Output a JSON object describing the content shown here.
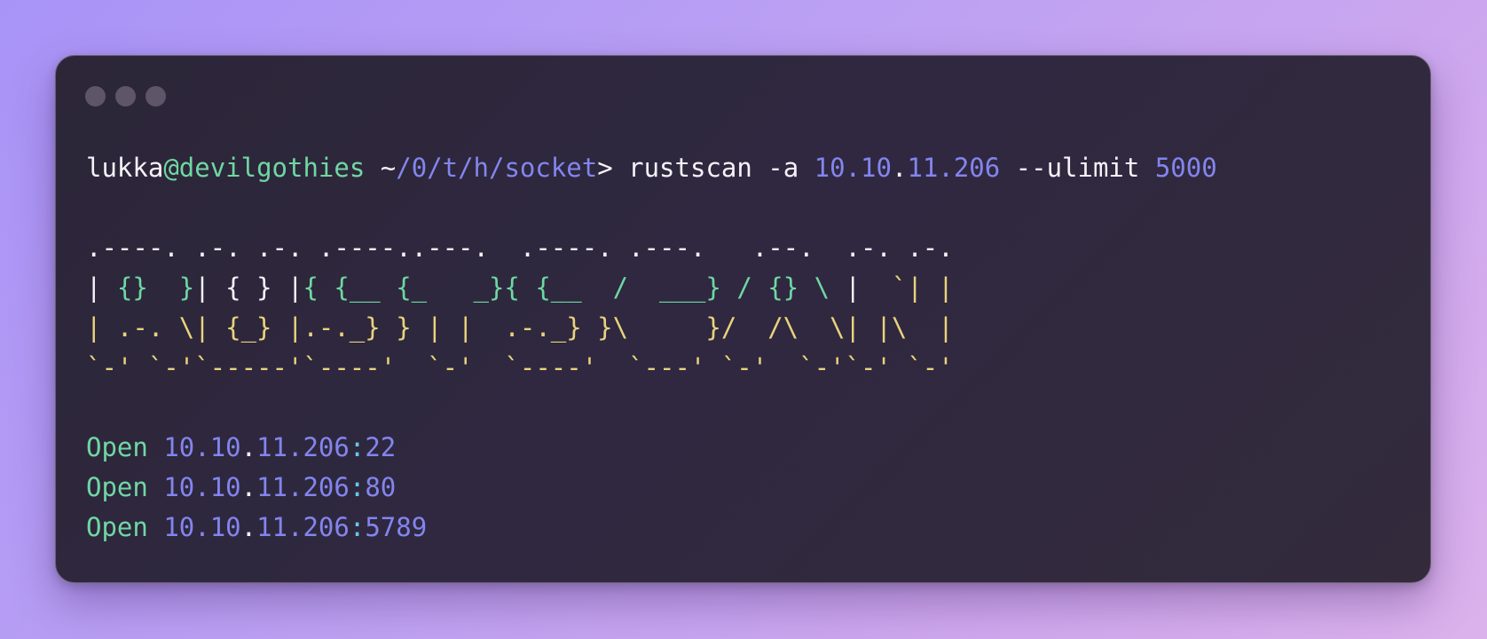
{
  "window": {
    "controls": [
      "close",
      "minimize",
      "maximize"
    ]
  },
  "prompt": {
    "user": "lukka",
    "host": "@devilgothies",
    "space": " ",
    "tilde": "~",
    "path": "/0/t/h/socket",
    "arrow": "> ",
    "command": "rustscan -a ",
    "ip_a": "10.10",
    "ip_dot": ".",
    "ip_b": "11.206",
    "flag": " --ulimit ",
    "limit": "5000"
  },
  "banner": {
    "line1": ".----. .-. .-. .----..---.  .----. .---.   .--.  .-. .-.",
    "line2": {
      "a": "| ",
      "b": "{}",
      "c": "  ",
      "d": "}",
      "e": "| { } |",
      "f": "{ {__ {_   _}{ {__  /  ___} / {} \\",
      "g": " | ",
      "h": " `| |"
    },
    "line3": "| .-. \\| {_} |.-._} } | |  .-._} }\\     }/  /\\  \\| |\\  |",
    "line4": "`-' `-'`-----'`----'  `-'  `----'  `---' `-'  `-'`-' `-'"
  },
  "results": [
    {
      "status": "Open",
      "ip_a": "10.10",
      "ip_dot": ".",
      "ip_b": "11.206",
      "colon": ":",
      "port": "22"
    },
    {
      "status": "Open",
      "ip_a": "10.10",
      "ip_dot": ".",
      "ip_b": "11.206",
      "colon": ":",
      "port": "80"
    },
    {
      "status": "Open",
      "ip_a": "10.10",
      "ip_dot": ".",
      "ip_b": "11.206",
      "colon": ":",
      "port": "5789"
    }
  ]
}
